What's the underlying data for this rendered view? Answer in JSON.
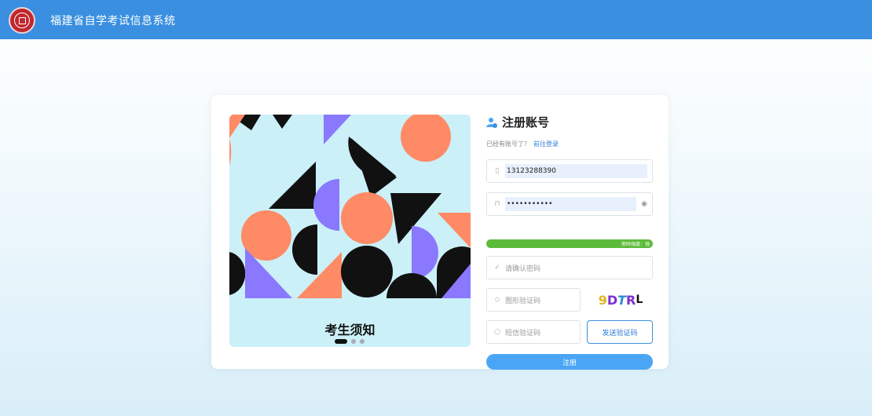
{
  "header": {
    "title": "福建省自学考试信息系统",
    "logo_icon": "emblem-icon",
    "color": "#3a8fe0"
  },
  "carousel": {
    "title": "考生须知",
    "slide_count": 3,
    "active_index": 0
  },
  "form": {
    "title": "注册账号",
    "title_icon": "user-add-icon",
    "have_account_text": "已经有账号了？",
    "login_link": "前往登录",
    "phone": {
      "value": "13123288390",
      "icon": "phone-icon"
    },
    "password": {
      "value": "•••••••••••",
      "icon": "lock-icon",
      "toggle_icon": "eye-icon"
    },
    "password_strength": {
      "label": "密码强度：强",
      "level": 1.0,
      "color": "#5dbb3b"
    },
    "confirm_password": {
      "placeholder": "请确认密码",
      "icon": "check-icon"
    },
    "image_captcha": {
      "placeholder": "图形验证码",
      "icon": "shield-icon",
      "captcha_text": "9DTRL"
    },
    "sms_code": {
      "placeholder": "短信验证码",
      "icon": "message-icon"
    },
    "send_code_button": "发送验证码",
    "register_button": "注册",
    "accent": "#4aa6f5"
  }
}
